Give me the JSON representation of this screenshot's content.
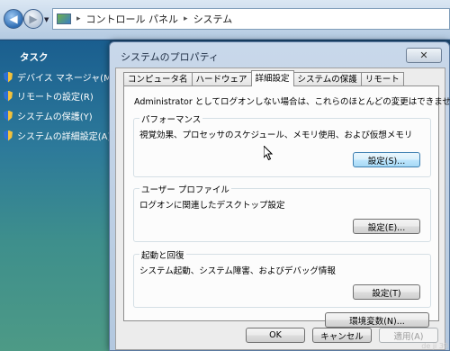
{
  "address_bar": {
    "path": [
      "コントロール パネル",
      "システム"
    ]
  },
  "task_pane": {
    "title": "タスク",
    "items": [
      {
        "label": "デバイス マネージャ(M"
      },
      {
        "label": "リモートの設定(R)"
      },
      {
        "label": "システムの保護(Y)"
      },
      {
        "label": "システムの詳細設定(A)"
      }
    ]
  },
  "dialog": {
    "title": "システムのプロパティ",
    "close_glyph": "✕",
    "tabs": [
      {
        "label": "コンピュータ名",
        "active": false
      },
      {
        "label": "ハードウェア",
        "active": false
      },
      {
        "label": "詳細設定",
        "active": true
      },
      {
        "label": "システムの保護",
        "active": false
      },
      {
        "label": "リモート",
        "active": false
      }
    ],
    "admin_note": "Administrator としてログオンしない場合は、これらのほとんどの変更はできません。",
    "performance": {
      "legend": "パフォーマンス",
      "description": "視覚効果、プロセッサのスケジュール、メモリ使用、および仮想メモリ",
      "button": "設定(S)..."
    },
    "user_profile": {
      "legend": "ユーザー プロファイル",
      "description": "ログオンに関連したデスクトップ設定",
      "button": "設定(E)..."
    },
    "startup_recovery": {
      "legend": "起動と回復",
      "description": "システム起動、システム障害、およびデバッグ情報",
      "button": "設定(T)"
    },
    "env_button": "環境変数(N)...",
    "ok_button": "OK",
    "cancel_button": "キャンセル",
    "apply_button": "適用(A)"
  },
  "watermark": "de ji 39",
  "colors": {
    "accent": "#3c7fb1",
    "task_pane_top": "#1a5e8f",
    "task_pane_bottom": "#4d9a86"
  }
}
